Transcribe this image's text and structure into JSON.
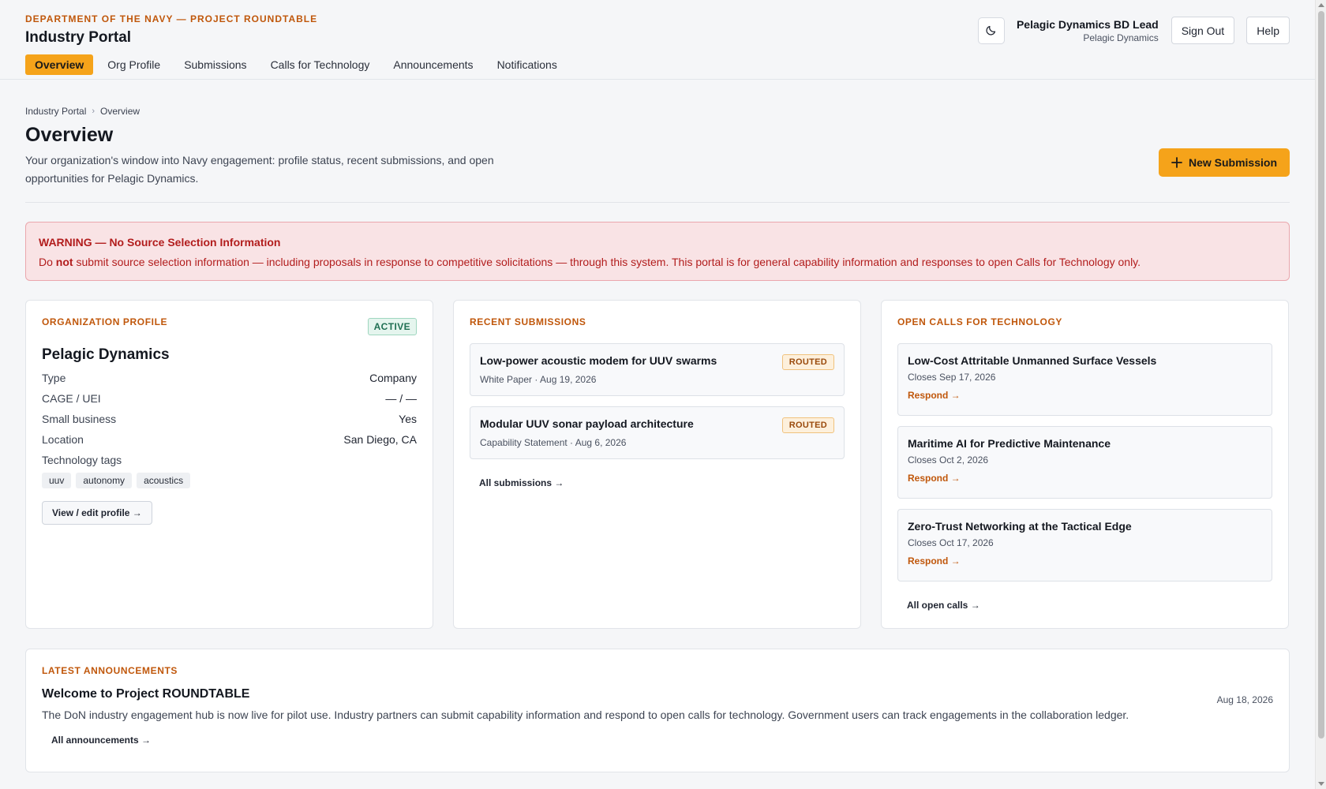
{
  "header": {
    "eyebrow": "DEPARTMENT OF THE NAVY — PROJECT ROUNDTABLE",
    "title": "Industry Portal",
    "nav": [
      {
        "label": "Overview",
        "active": true
      },
      {
        "label": "Org Profile"
      },
      {
        "label": "Submissions"
      },
      {
        "label": "Calls for Technology"
      },
      {
        "label": "Announcements"
      },
      {
        "label": "Notifications"
      }
    ],
    "theme_icon": "moon-icon",
    "user_name": "Pelagic Dynamics BD Lead",
    "user_org": "Pelagic Dynamics",
    "sign_out_label": "Sign Out",
    "help_label": "Help"
  },
  "breadcrumb": {
    "root": "Industry Portal",
    "current": "Overview"
  },
  "page": {
    "title": "Overview",
    "intro": "Your organization's window into Navy engagement: profile status, recent submissions, and open opportunities for Pelagic Dynamics.",
    "new_submission_label": "New Submission"
  },
  "warning": {
    "title": "WARNING — No Source Selection Information",
    "text_before": "Do ",
    "text_bold": "not",
    "text_after": " submit source selection information — including proposals in response to competitive solicitations — through this system. This portal is for general capability information and responses to open Calls for Technology only."
  },
  "org_profile": {
    "label": "ORGANIZATION PROFILE",
    "status": "ACTIVE",
    "name": "Pelagic Dynamics",
    "fields": [
      {
        "key": "Type",
        "value": "Company"
      },
      {
        "key": "CAGE / UEI",
        "value": "— / —"
      },
      {
        "key": "Small business",
        "value": "Yes"
      },
      {
        "key": "Location",
        "value": "San Diego, CA"
      }
    ],
    "tags_label": "Technology tags",
    "tags": [
      "uuv",
      "autonomy",
      "acoustics"
    ],
    "edit_label": "View / edit profile →"
  },
  "recent_submissions": {
    "label": "RECENT SUBMISSIONS",
    "items": [
      {
        "title": "Low-power acoustic modem for UUV swarms",
        "meta": "White Paper · Aug 19, 2026",
        "status": "ROUTED"
      },
      {
        "title": "Modular UUV sonar payload architecture",
        "meta": "Capability Statement · Aug 6, 2026",
        "status": "ROUTED"
      }
    ],
    "all_label": "All submissions →"
  },
  "open_calls": {
    "label": "OPEN CALLS FOR TECHNOLOGY",
    "items": [
      {
        "title": "Low-Cost Attritable Unmanned Surface Vessels",
        "closes": "Closes Sep 17, 2026",
        "action": "Respond →"
      },
      {
        "title": "Maritime AI for Predictive Maintenance",
        "closes": "Closes Oct 2, 2026",
        "action": "Respond →"
      },
      {
        "title": "Zero-Trust Networking at the Tactical Edge",
        "closes": "Closes Oct 17, 2026",
        "action": "Respond →"
      }
    ],
    "all_label": "All open calls →"
  },
  "announcements": {
    "label": "LATEST ANNOUNCEMENTS",
    "title": "Welcome to Project ROUNDTABLE",
    "date": "Aug 18, 2026",
    "body": "The DoN industry engagement hub is now live for pilot use. Industry partners can submit capability information and respond to open calls for technology. Government users can track engagements in the collaboration ledger.",
    "all_label": "All announcements →"
  },
  "colors": {
    "accent": "#f5a31a",
    "eyebrow": "#c0570b",
    "warning_bg": "#f9e3e5",
    "warning_text": "#b21d1d",
    "active_badge": "#1f6f52"
  }
}
